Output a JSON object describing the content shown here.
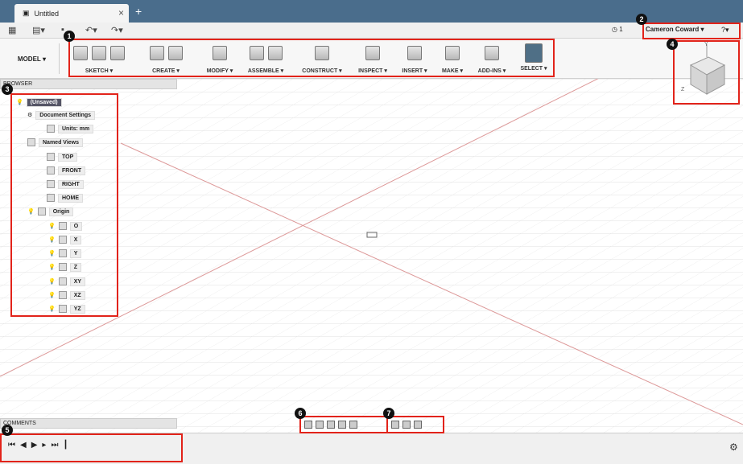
{
  "document": {
    "tab_title": "Untitled"
  },
  "quick_access": {
    "jobs_count": "1"
  },
  "user": {
    "name": "Cameron Coward"
  },
  "workspace": {
    "label": "MODEL"
  },
  "toolbar": {
    "groups": [
      "SKETCH",
      "CREATE",
      "MODIFY",
      "ASSEMBLE",
      "CONSTRUCT",
      "INSPECT",
      "INSERT",
      "MAKE",
      "ADD-INS",
      "SELECT"
    ]
  },
  "browser": {
    "header": "BROWSER",
    "root_label": "(Unsaved)",
    "document_settings": "Document Settings",
    "units": "Units: mm",
    "named_views": "Named Views",
    "views": [
      "TOP",
      "FRONT",
      "RIGHT",
      "HOME"
    ],
    "origin": "Origin",
    "origin_items": [
      "O",
      "X",
      "Y",
      "Z",
      "XY",
      "XZ",
      "YZ"
    ]
  },
  "comments": {
    "header": "COMMENTS"
  },
  "callouts": [
    "1",
    "2",
    "3",
    "4",
    "5",
    "6",
    "7"
  ],
  "viewcube": {
    "labels": [
      "Y",
      "Z"
    ]
  }
}
